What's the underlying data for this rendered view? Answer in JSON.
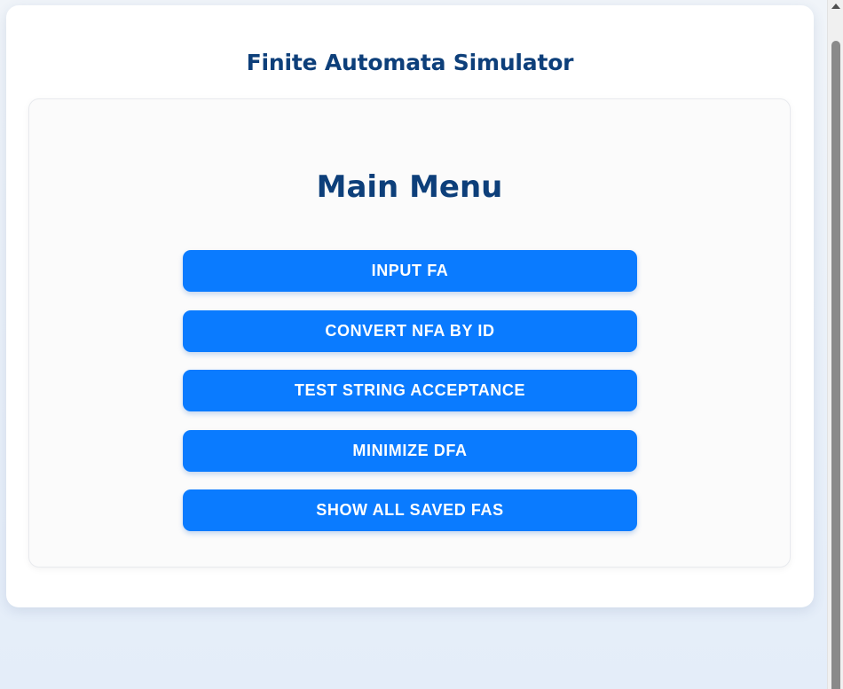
{
  "app": {
    "title": "Finite Automata Simulator"
  },
  "menu": {
    "heading": "Main Menu",
    "buttons": [
      {
        "label": "INPUT FA"
      },
      {
        "label": "CONVERT NFA BY ID"
      },
      {
        "label": "TEST STRING ACCEPTANCE"
      },
      {
        "label": "MINIMIZE DFA"
      },
      {
        "label": "SHOW ALL SAVED FAS"
      }
    ]
  },
  "colors": {
    "primary_button": "#0a7bff",
    "heading_text": "#0d3f7a",
    "button_text": "#ffffff"
  }
}
